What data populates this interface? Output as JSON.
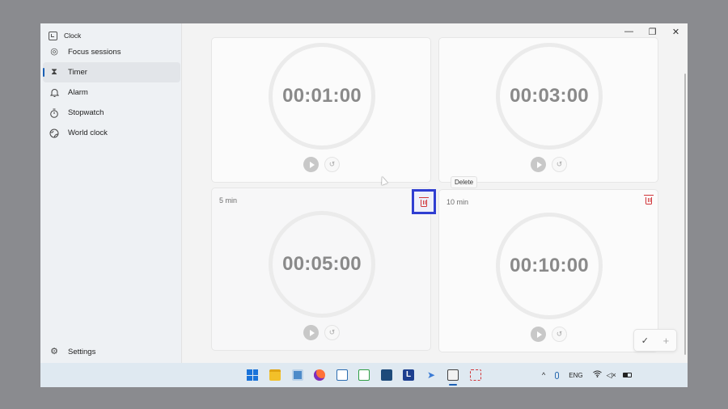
{
  "app": {
    "title": "Clock"
  },
  "window_controls": {
    "minimize": "—",
    "restore": "❐",
    "close": "✕"
  },
  "sidebar": {
    "items": [
      {
        "label": "Focus sessions",
        "icon": "focus-icon",
        "active": false
      },
      {
        "label": "Timer",
        "icon": "hourglass-icon",
        "active": true
      },
      {
        "label": "Alarm",
        "icon": "bell-icon",
        "active": false
      },
      {
        "label": "Stopwatch",
        "icon": "stopwatch-icon",
        "active": false
      },
      {
        "label": "World clock",
        "icon": "globe-icon",
        "active": false
      }
    ],
    "settings_label": "Settings"
  },
  "timers": [
    {
      "label": "",
      "time": "00:01:00"
    },
    {
      "label": "",
      "time": "00:03:00"
    },
    {
      "label": "5 min",
      "time": "00:05:00"
    },
    {
      "label": "10 min",
      "time": "00:10:00"
    }
  ],
  "tooltip": {
    "delete": "Delete"
  },
  "editbar": {
    "done": "✓",
    "add": "+"
  },
  "taskbar": {
    "language": "ENG",
    "chevron": "^"
  },
  "colors": {
    "accent": "#1a5fb4",
    "delete": "#d13438",
    "highlight": "#2f3ed1"
  }
}
